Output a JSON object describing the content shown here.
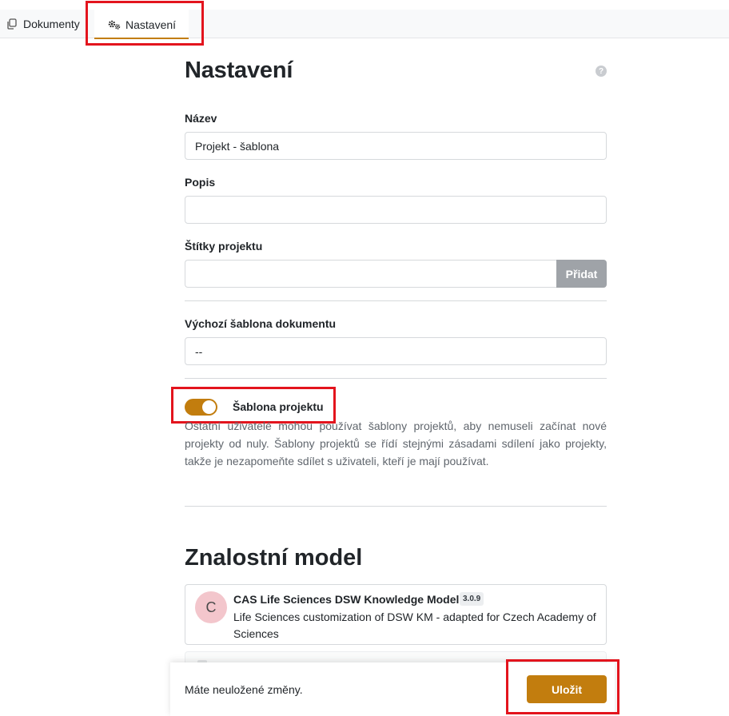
{
  "tabs": {
    "documents": "Dokumenty",
    "settings": "Nastavení"
  },
  "page": {
    "title": "Nastavení",
    "help": "?"
  },
  "form": {
    "name_label": "Název",
    "name_value": "Projekt - šablona",
    "description_label": "Popis",
    "description_value": "",
    "tags_label": "Štítky projektu",
    "tags_value": "",
    "tags_add_button": "Přidat",
    "default_template_label": "Výchozí šablona dokumentu",
    "default_template_value": "--",
    "template_toggle_label": "Šablona projektu",
    "template_toggle_on": true,
    "template_help": "Ostatní uživatelé mohou používat šablony projektů, aby nemuseli začínat nové projekty od nuly. Šablony projektů se řídí stejnými zásadami sdílení jako projekty, takže je nezapomeňte sdílet s uživateli, kteří je mají používat."
  },
  "knowledge_model": {
    "title": "Znalostní model",
    "avatar_letter": "C",
    "name": "CAS Life Sciences DSW Knowledge Model",
    "version": "3.0.9",
    "description": "Life Sciences customization of DSW KM - adapted for Czech Academy of Sciences"
  },
  "save_bar": {
    "message": "Máte neuložené změny.",
    "save_button": "Uložit"
  },
  "colors": {
    "accent": "#c27d0e",
    "highlight": "#e3141d",
    "disabled_button": "#9fa3a8"
  }
}
